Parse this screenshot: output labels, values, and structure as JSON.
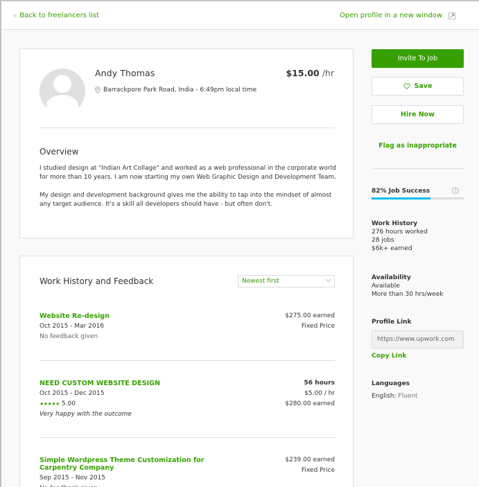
{
  "topbar": {
    "back_label": "Back to freelancers list",
    "open_label": "Open profile in a new window"
  },
  "profile": {
    "name": "Andy Thomas",
    "rate_amount": "$15.00",
    "rate_unit": "/hr",
    "location": "Barrackpore Park Road, India - 6:49pm local time",
    "overview_title": "Overview",
    "overview_paragraphs": [
      "I studied design at \"Indian Art Collage\" and worked as a web professional in the corporate world for more than 10 years. I am now starting my own Web Graphic Design and Development Team.",
      "My design and development background gives me the ability to tap into the mindset of almost any target audience. It's a skill all developers should have - but often don't."
    ]
  },
  "work_history": {
    "title": "Work History and Feedback",
    "sort_selected": "Newest first",
    "jobs": [
      {
        "title": "Website Re-design",
        "dates": "Oct 2015 - Mar 2016",
        "feedback": "No feedback given",
        "right": [
          "$275.00 earned",
          "Fixed Price"
        ]
      },
      {
        "title": "NEED CUSTOM WEBSITE DESIGN",
        "dates": "Oct 2015 - Dec 2015",
        "rating": "5.00",
        "stars": "★★★★★",
        "comment": "Very happy with the outcome",
        "right": [
          "56 hours",
          "$5.00 / hr",
          "$280.00 earned"
        ]
      },
      {
        "title": "Simple Wordpress Theme Customization for Carpentry Company",
        "dates": "Sep 2015 - Nov 2015",
        "feedback": "No feedback given",
        "right": [
          "$239.00 earned",
          "Fixed Price"
        ]
      }
    ]
  },
  "sidebar": {
    "invite_label": "Invite To Job",
    "save_label": "Save",
    "hire_label": "Hire Now",
    "flag_label": "Flag as inappropriate",
    "job_success_label": "82% Job Success",
    "job_success_percent": 82,
    "work_history_title": "Work History",
    "hours_worked": "276 hours worked",
    "jobs_count": "28 jobs",
    "earned": "$6k+ earned",
    "availability_title": "Availability",
    "availability_status": "Available",
    "availability_hours": "More than 30 hrs/week",
    "profile_link_title": "Profile Link",
    "profile_link_value": "https://www.upwork.com",
    "copy_link_label": "Copy Link",
    "languages_title": "Languages",
    "language_name": "English:",
    "language_level": "Fluent"
  },
  "colors": {
    "brand_green": "#37a000",
    "success_bar": "#14bff4"
  }
}
